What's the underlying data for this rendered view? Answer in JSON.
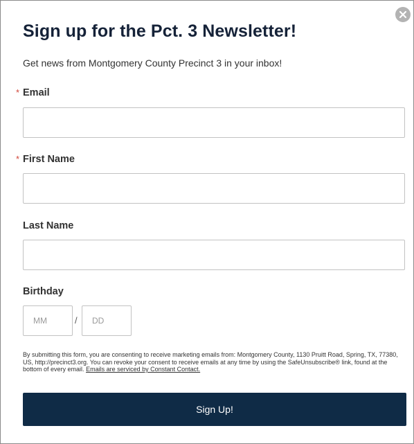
{
  "form": {
    "title": "Sign up for the Pct. 3 Newsletter!",
    "subtitle": "Get news from Montgomery County Precinct 3 in your inbox!",
    "required_marker": "*",
    "email": {
      "label": "Email",
      "value": "",
      "required": true
    },
    "first_name": {
      "label": "First Name",
      "value": "",
      "required": true
    },
    "last_name": {
      "label": "Last Name",
      "value": "",
      "required": false
    },
    "birthday": {
      "label": "Birthday",
      "month_placeholder": "MM",
      "day_placeholder": "DD",
      "separator": "/"
    },
    "consent_text": "By submitting this form, you are consenting to receive marketing emails from: Montgomery County, 1130 Pruitt Road, Spring, TX, 77380, US, http://precinct3.org. You can revoke your consent to receive emails at any time by using the SafeUnsubscribe® link, found at the bottom of every email.",
    "consent_link": "Emails are serviced by Constant Contact.",
    "submit_label": "Sign Up!"
  },
  "icons": {
    "close": "close-circle-icon"
  },
  "colors": {
    "title": "#152238",
    "button_bg": "#0f2b46",
    "required": "#d2473b",
    "close_bg": "#b3b3b3"
  }
}
